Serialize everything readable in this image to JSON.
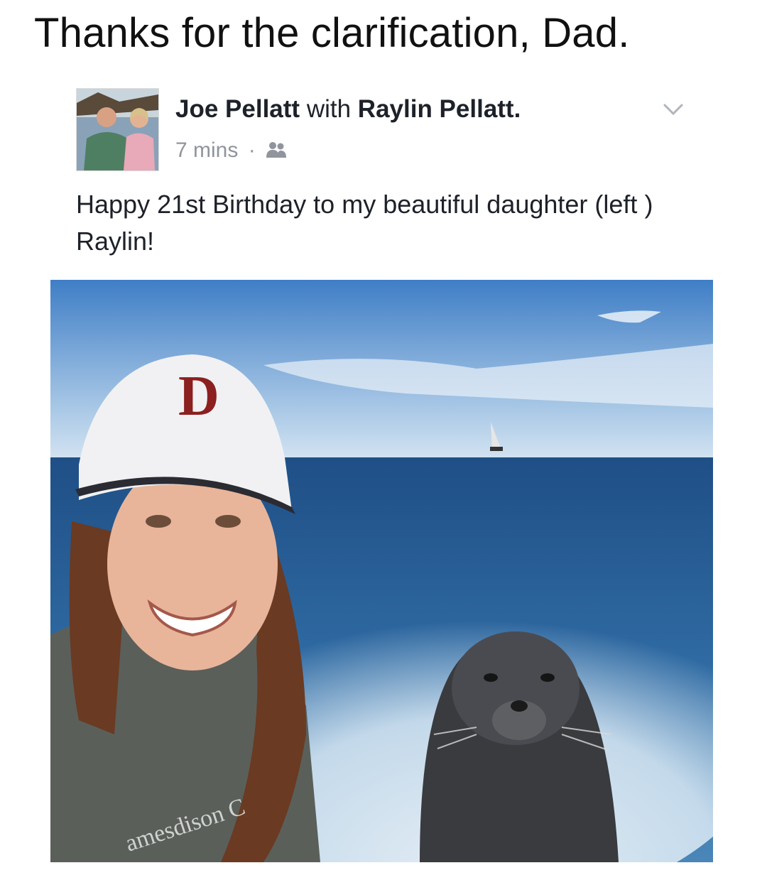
{
  "caption": "Thanks for the clarification, Dad.",
  "post": {
    "author": "Joe Pellatt",
    "with_word": "with",
    "tagged": "Raylin Pellatt.",
    "time": "7 mins",
    "separator": "·",
    "audience_icon": "friends-icon",
    "menu_icon": "chevron-down-icon",
    "text": "Happy 21st Birthday to my beautiful daughter (left ) Raylin!",
    "photo": {
      "cap_logo": "D",
      "shirt_text": "amesdison C"
    }
  },
  "colors": {
    "meta_gray": "#90949c",
    "text_dark": "#1d2129"
  }
}
